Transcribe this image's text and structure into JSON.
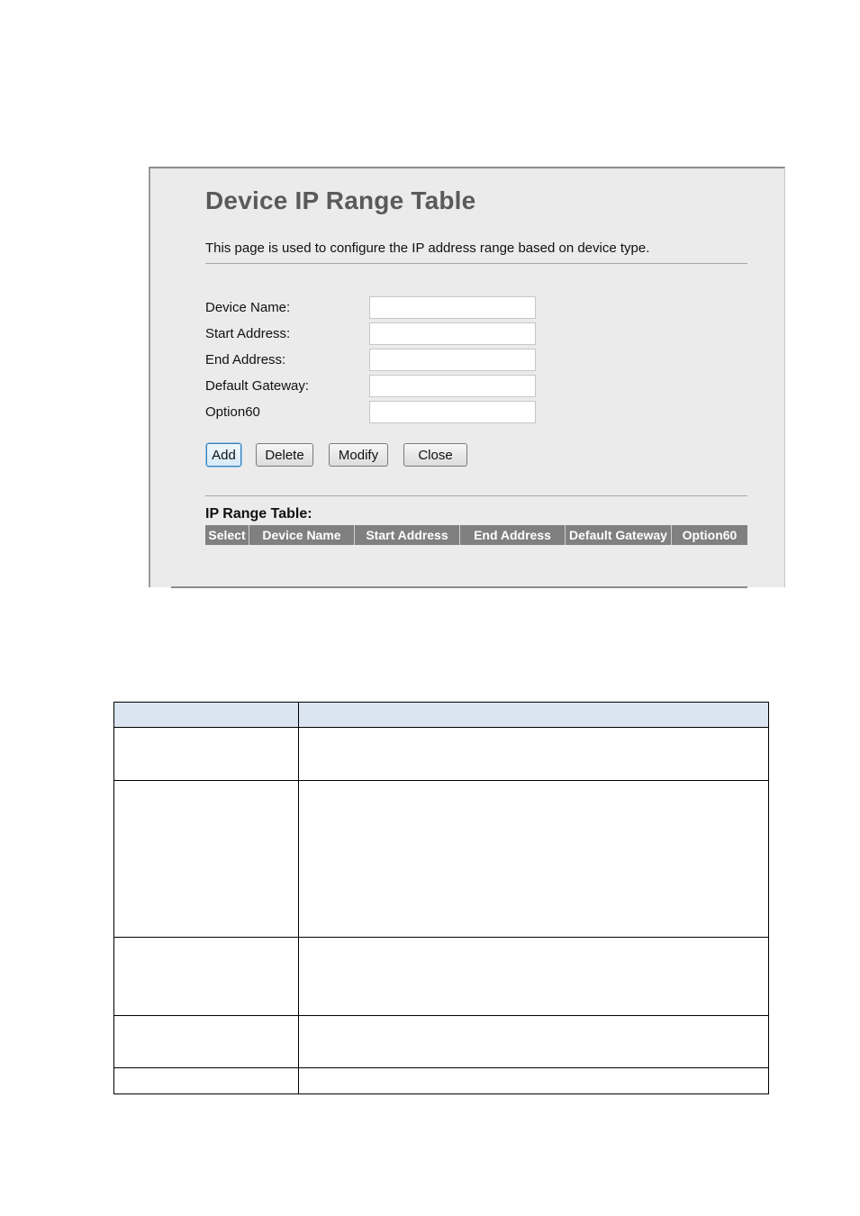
{
  "page": {
    "title": "Device IP Range Table",
    "description": "This page is used to configure the IP address range based on device type."
  },
  "form": {
    "fields": [
      {
        "label": "Device Name:",
        "value": ""
      },
      {
        "label": "Start Address:",
        "value": ""
      },
      {
        "label": "End Address:",
        "value": ""
      },
      {
        "label": "Default Gateway:",
        "value": ""
      },
      {
        "label": "Option60",
        "value": ""
      }
    ]
  },
  "buttons": {
    "add": "Add",
    "delete": "Delete",
    "modify": "Modify",
    "close": "Close"
  },
  "ip_table": {
    "title": "IP Range Table:",
    "columns": [
      "Select",
      "Device Name",
      "Start Address",
      "End Address",
      "Default Gateway",
      "Option60"
    ],
    "rows": []
  },
  "desc_table": {
    "header": [
      "",
      ""
    ],
    "rows": [
      [
        "",
        ""
      ],
      [
        "",
        ""
      ],
      [
        "",
        ""
      ],
      [
        "",
        ""
      ],
      [
        "",
        ""
      ]
    ]
  }
}
